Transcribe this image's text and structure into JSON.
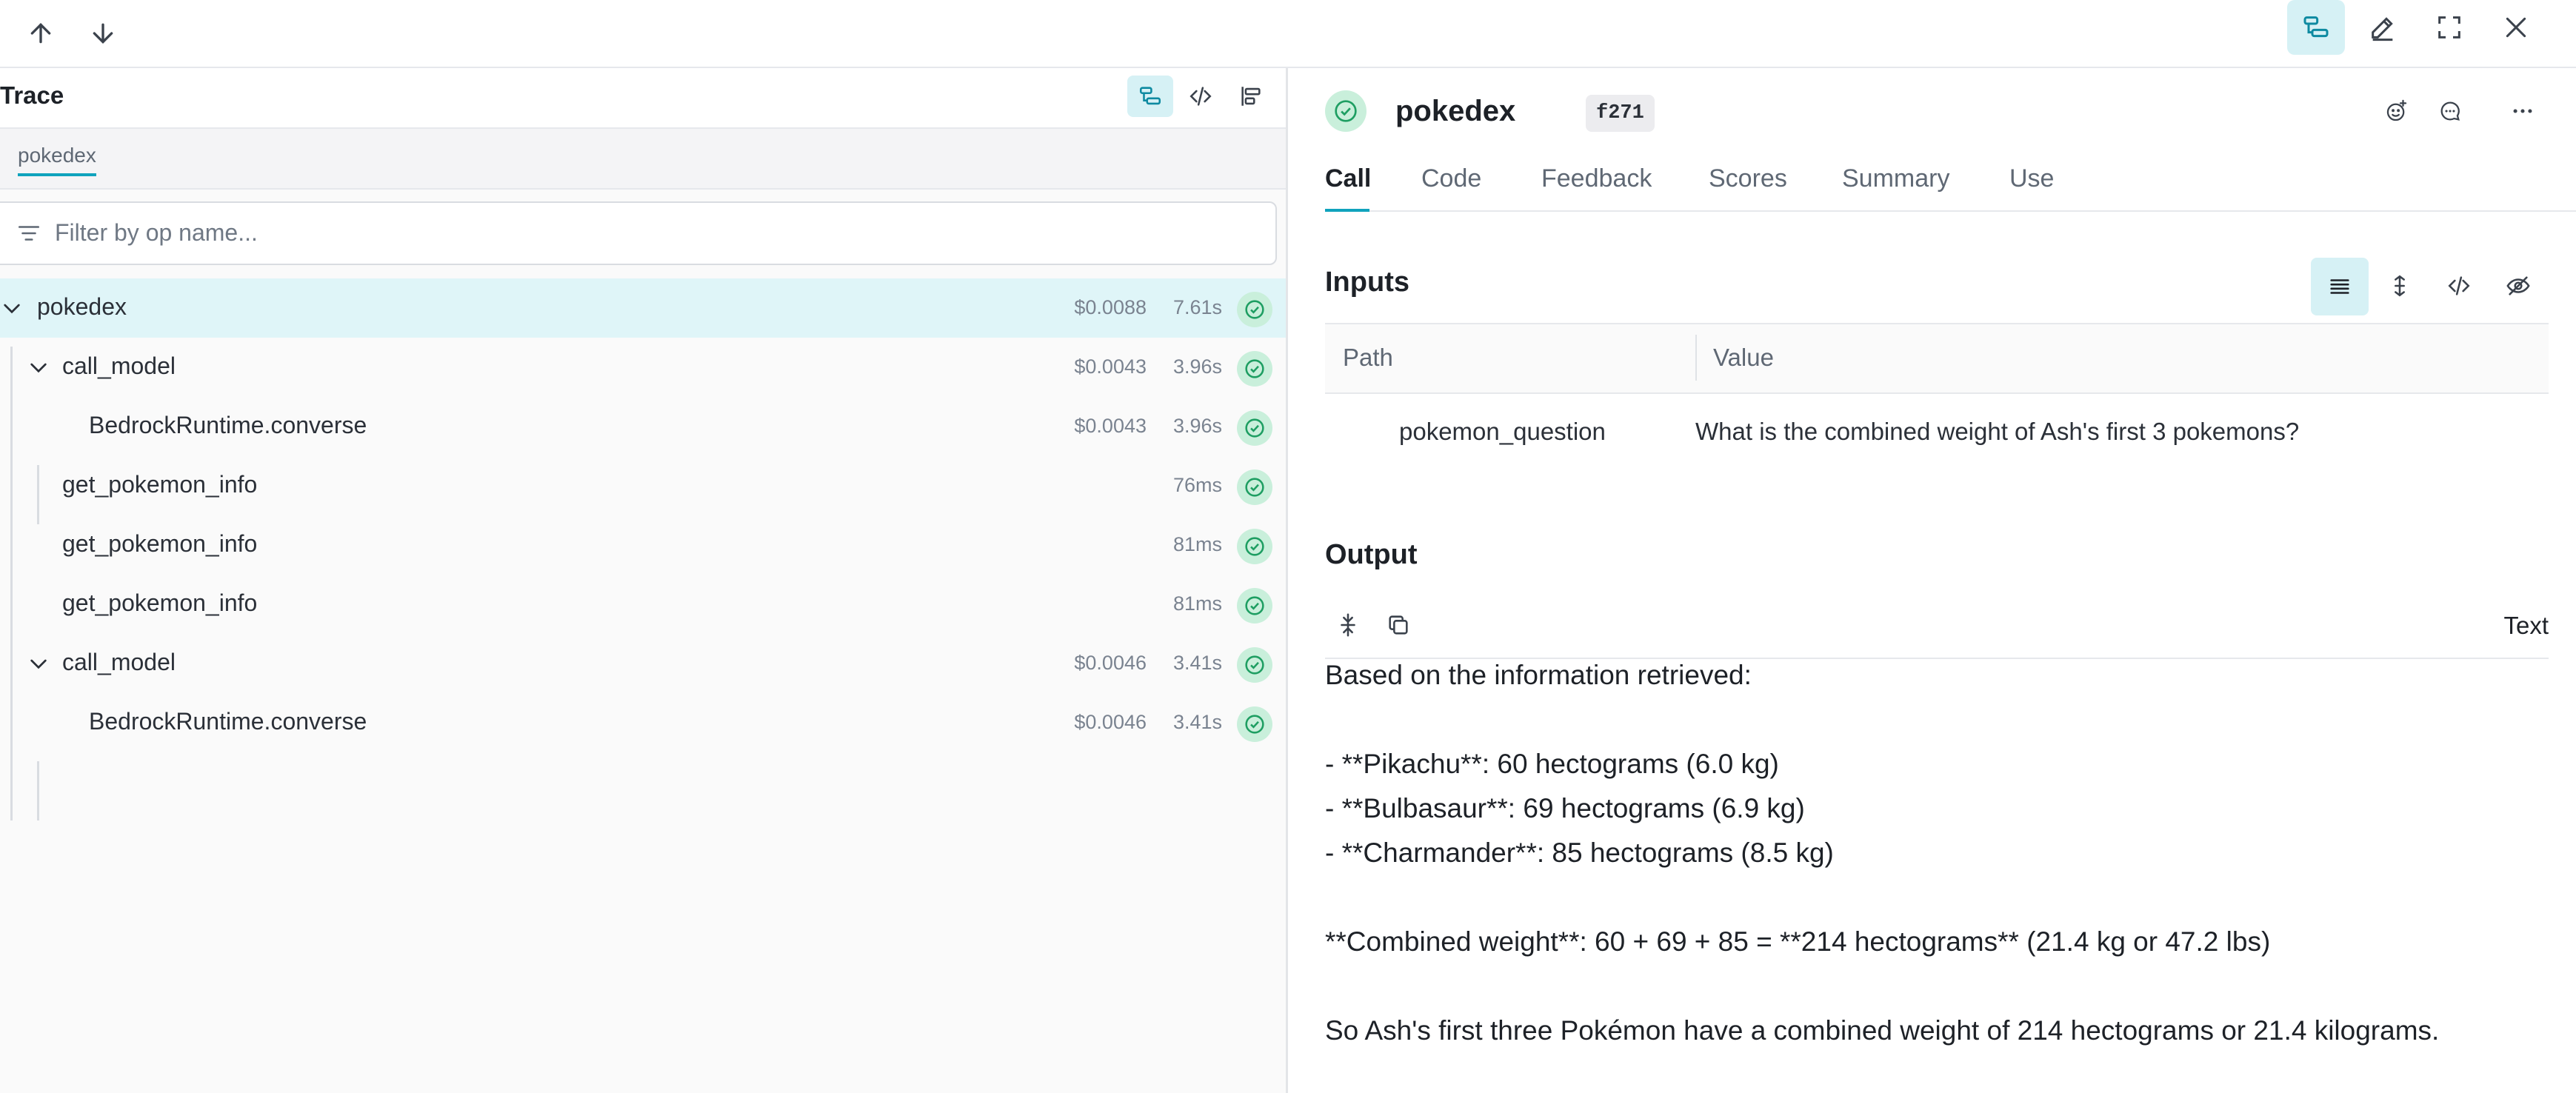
{
  "topbar": {
    "prev_icon": "arrow-up-icon",
    "next_icon": "arrow-down-icon",
    "right_icons": [
      "trace-tree-icon",
      "pencil-icon",
      "fullscreen-icon",
      "close-icon"
    ]
  },
  "trace": {
    "title": "Trace",
    "view_icons": [
      "trace-tree-icon",
      "code-icon",
      "timeline-icon"
    ],
    "tab": "pokedex",
    "filter_placeholder": "Filter by op name...",
    "rows": [
      {
        "name": "pokedex",
        "cost": "$0.0088",
        "duration": "7.61s",
        "depth": 0,
        "expanded": true,
        "selected": true
      },
      {
        "name": "call_model",
        "cost": "$0.0043",
        "duration": "3.96s",
        "depth": 1,
        "expanded": true,
        "selected": false
      },
      {
        "name": "BedrockRuntime.converse",
        "cost": "$0.0043",
        "duration": "3.96s",
        "depth": 2,
        "selected": false
      },
      {
        "name": "get_pokemon_info",
        "cost": "",
        "duration": "76ms",
        "depth": 1,
        "selected": false
      },
      {
        "name": "get_pokemon_info",
        "cost": "",
        "duration": "81ms",
        "depth": 1,
        "selected": false
      },
      {
        "name": "get_pokemon_info",
        "cost": "",
        "duration": "81ms",
        "depth": 1,
        "selected": false
      },
      {
        "name": "call_model",
        "cost": "$0.0046",
        "duration": "3.41s",
        "depth": 1,
        "expanded": true,
        "selected": false
      },
      {
        "name": "BedrockRuntime.converse",
        "cost": "$0.0046",
        "duration": "3.41s",
        "depth": 2,
        "selected": false
      }
    ]
  },
  "call": {
    "title": "pokedex",
    "badge": "f271",
    "header_icons": [
      "emoji-add-icon",
      "comment-icon",
      "more-icon"
    ],
    "tabs": [
      "Call",
      "Code",
      "Feedback",
      "Scores",
      "Summary",
      "Use"
    ],
    "active_tab": "Call",
    "inputs": {
      "title": "Inputs",
      "view_icons": [
        "list-view-icon",
        "expand-vertical-icon",
        "code-icon",
        "hide-icon"
      ],
      "columns": [
        "Path",
        "Value"
      ],
      "rows": [
        {
          "path": "pokemon_question",
          "value": "What is the combined weight of Ash's first 3 pokemons?"
        }
      ]
    },
    "output": {
      "title": "Output",
      "tool_icons": [
        "collapse-icon",
        "copy-icon"
      ],
      "format": "Text",
      "text": "Based on the information retrieved:\n\n- **Pikachu**: 60 hectograms (6.0 kg)\n- **Bulbasaur**: 69 hectograms (6.9 kg)\n- **Charmander**: 85 hectograms (8.5 kg)\n\n**Combined weight**: 60 + 69 + 85 = **214 hectograms** (21.4 kg or 47.2 lbs)\n\nSo Ash's first three Pokémon have a combined weight of 214 hectograms or 21.4 kilograms."
    }
  },
  "colors": {
    "accent": "#10a3bd",
    "selected_row": "#dff5f8",
    "success": "#1e9e62",
    "success_bg": "#c9efdb"
  }
}
